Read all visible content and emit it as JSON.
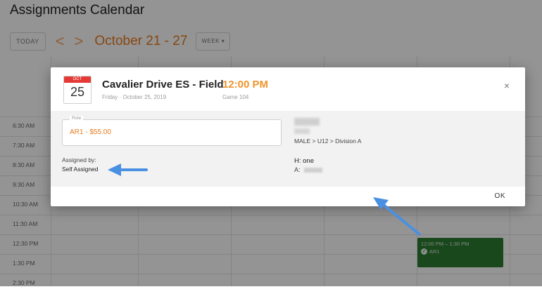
{
  "page": {
    "title": "Assignments Calendar",
    "toolbar": {
      "today_label": "TODAY",
      "prev_glyph": "<",
      "next_glyph": ">",
      "range_label": "October 21 - 27",
      "view_label": "WEEK ▾"
    },
    "time_slots": [
      "6:30 AM",
      "7:30 AM",
      "8:30 AM",
      "9:30 AM",
      "10:30 AM",
      "11:30 AM",
      "12:30 PM",
      "1:30 PM",
      "2:30 PM"
    ],
    "event": {
      "time": "12:00 PM – 1:30 PM",
      "name": "AR1",
      "color": "#2e7d32"
    }
  },
  "modal": {
    "date_badge": {
      "month": "OCT",
      "day": "25"
    },
    "field_name": "Cavalier Drive ES - Field",
    "date_text": "Friday · October 25, 2019",
    "time": "12:00 PM",
    "game": "Game 104",
    "close_glyph": "×",
    "role_label": "Role",
    "role_value": "AR1 - $55.00",
    "division": "MALE > U12 > Division A",
    "assigned_by_label": "Assigned by:",
    "assigned_by_value": "Self Assigned",
    "home_team": "H: one",
    "away_prefix": "A:",
    "ok_label": "OK"
  },
  "colors": {
    "accent_orange": "#e87b1e",
    "time_orange": "#f0932b",
    "event_green": "#2e7d32",
    "annotation_arrow": "#4a90e2"
  }
}
